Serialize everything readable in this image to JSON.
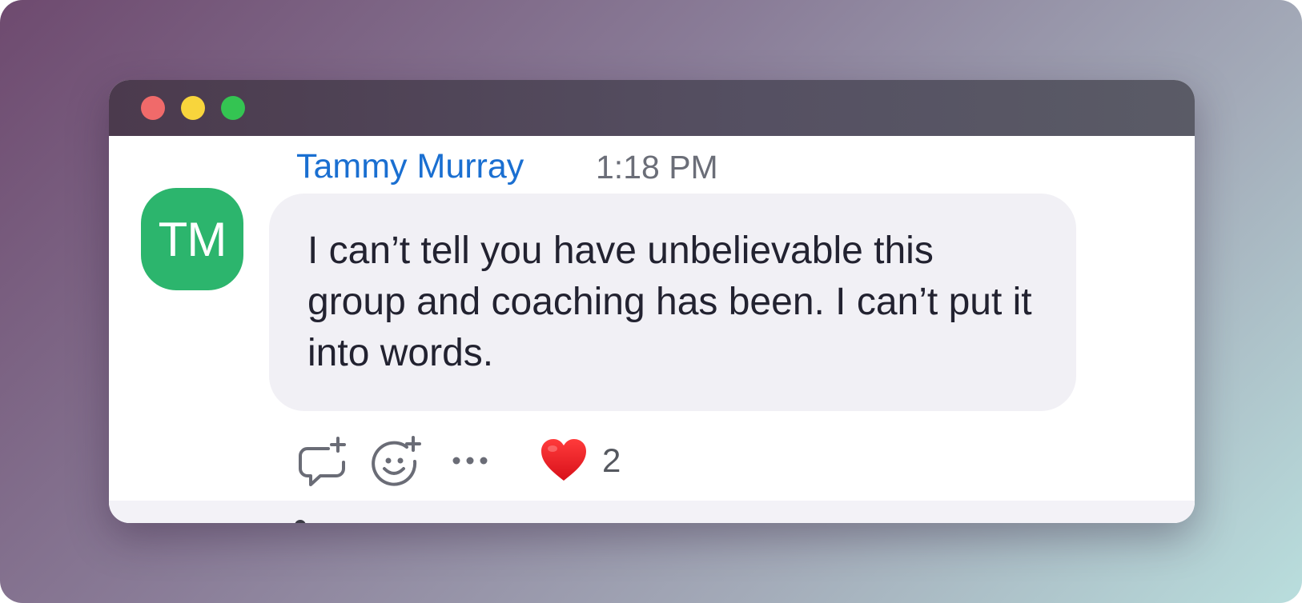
{
  "message": {
    "avatar_initials": "TM",
    "avatar_color": "#2cb56d",
    "sender_name": "Tammy Murray",
    "sender_color": "#1a6fd1",
    "timestamp": "1:18 PM",
    "text": "I can’t tell you have unbelievable this group and coaching has been. I can’t put it into words."
  },
  "actions": {
    "reply_icon": "reply-in-thread-icon",
    "react_icon": "add-reaction-icon",
    "more_icon": "more-options-icon"
  },
  "reactions": [
    {
      "emoji": "heart",
      "count": "2"
    }
  ],
  "colors": {
    "bubble": "#f1f0f5",
    "window_titlebar": "#4f4859",
    "traffic_red": "#f06a6a",
    "traffic_yellow": "#f8d53c",
    "traffic_green": "#34c452"
  }
}
